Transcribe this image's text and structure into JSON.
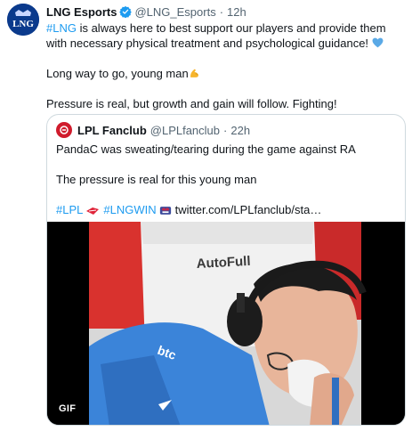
{
  "tweet": {
    "author_name": "LNG Esports",
    "author_handle": "@LNG_Esports",
    "separator": "·",
    "time": "12h",
    "body": {
      "hashtag": "#LNG",
      "line1_rest": " is always here to best support our players and provide them with necessary physical treatment and psychological guidance!",
      "line2": "Long way to go, young man",
      "line3": "Pressure is real, but growth and gain will follow. Fighting!"
    },
    "emoji": {
      "heart": "blue-heart-icon",
      "muscle": "flexed-biceps-icon"
    }
  },
  "quote": {
    "author_name": "LPL Fanclub",
    "author_handle": "@LPLfanclub",
    "separator": "·",
    "time": "22h",
    "line1": "PandaC was sweating/tearing during the game against RA",
    "line2": "The pressure is real for this young man",
    "hashtag1": "#LPL",
    "hashtag2": "#LNGWIN",
    "link": "twitter.com/LPLfanclub/sta…",
    "media": {
      "badge": "GIF",
      "chair_text": "AutoFull"
    }
  },
  "colors": {
    "accent": "#1d9bf0",
    "secondary_text": "#536471",
    "border": "#cfd9de",
    "lng_blue": "#0b3a8c",
    "lpl_red": "#d01b2c"
  }
}
